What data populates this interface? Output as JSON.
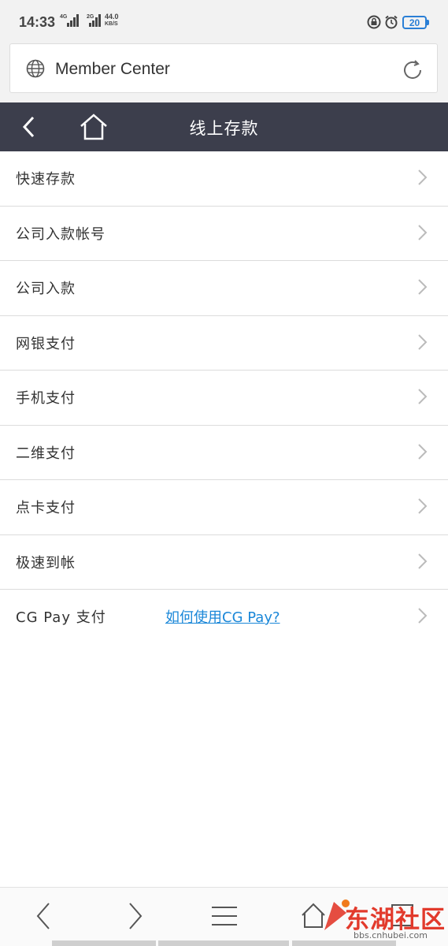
{
  "status_bar": {
    "time": "14:33",
    "network_1": "4G",
    "network_2": "2G",
    "speed_value": "44.0",
    "speed_unit": "KB/S",
    "battery": "20",
    "icons": [
      "lock-icon",
      "alarm-icon"
    ]
  },
  "address_bar": {
    "title": "Member Center",
    "icons": [
      "globe-icon",
      "reload-icon"
    ]
  },
  "header": {
    "title": "线上存款",
    "bg_color": "#3c3e4c"
  },
  "menu": {
    "items": [
      {
        "label": "快速存款"
      },
      {
        "label": "公司入款帐号"
      },
      {
        "label": "公司入款"
      },
      {
        "label": "网银支付"
      },
      {
        "label": "手机支付"
      },
      {
        "label": "二维支付"
      },
      {
        "label": "点卡支付"
      },
      {
        "label": "极速到帐"
      },
      {
        "label": "CG Pay 支付",
        "link": "如何使用CG Pay?"
      }
    ]
  },
  "bottom_nav": {
    "items": [
      "back-arrow-icon",
      "forward-arrow-icon",
      "menu-icon",
      "home-icon",
      "tabs-icon"
    ]
  },
  "watermark": {
    "text": "东湖社区",
    "url": "bbs.cnhubei.com"
  },
  "colors": {
    "link": "#1a87d8",
    "battery": "#2a7fd6",
    "watermark": "#e23a2c"
  }
}
